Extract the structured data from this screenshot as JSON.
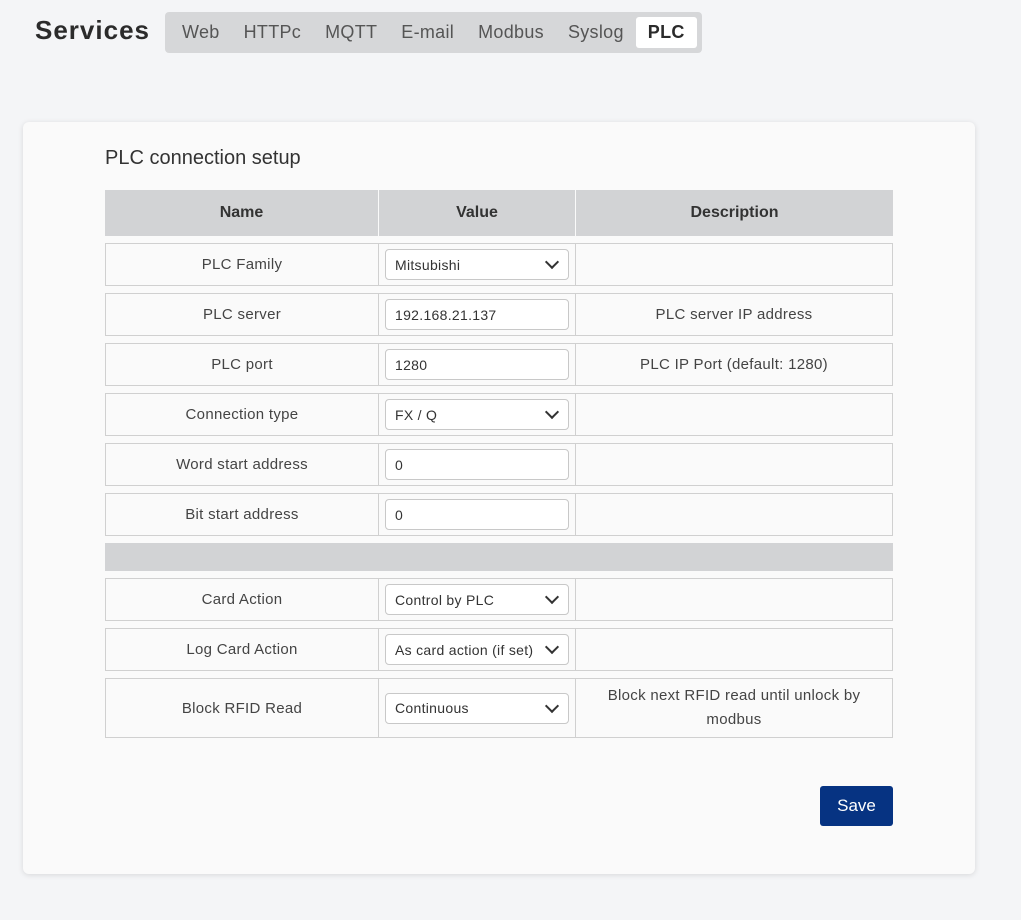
{
  "app": {
    "title": "Services"
  },
  "tabs": [
    {
      "label": "Web"
    },
    {
      "label": "HTTPc"
    },
    {
      "label": "MQTT"
    },
    {
      "label": "E-mail"
    },
    {
      "label": "Modbus"
    },
    {
      "label": "Syslog"
    },
    {
      "label": "PLC",
      "active": true
    }
  ],
  "section": {
    "title": "PLC connection setup"
  },
  "table": {
    "headers": {
      "name": "Name",
      "value": "Value",
      "description": "Description"
    },
    "rows": [
      {
        "name": "PLC Family",
        "value": "Mitsubishi",
        "kind": "select",
        "description": ""
      },
      {
        "name": "PLC server",
        "value": "192.168.21.137",
        "kind": "input",
        "description": "PLC server IP address"
      },
      {
        "name": "PLC port",
        "value": "1280",
        "kind": "input",
        "description": "PLC IP Port (default: 1280)"
      },
      {
        "name": "Connection type",
        "value": "FX / Q",
        "kind": "select",
        "description": ""
      },
      {
        "name": "Word start address",
        "value": "0",
        "kind": "input",
        "description": ""
      },
      {
        "name": "Bit start address",
        "value": "0",
        "kind": "input",
        "description": ""
      },
      {
        "name": "Card Action",
        "value": "Control by PLC",
        "kind": "select",
        "description": ""
      },
      {
        "name": "Log Card Action",
        "value": "As card action (if set)",
        "kind": "select",
        "description": ""
      },
      {
        "name": "Block RFID Read",
        "value": "Continuous",
        "kind": "select",
        "description": "Block next RFID read until unlock by modbus"
      }
    ]
  },
  "actions": {
    "save_label": "Save"
  },
  "colors": {
    "accent": "#063382",
    "tab_bar": "#d6d7d9",
    "header_row": "#d2d3d5"
  }
}
